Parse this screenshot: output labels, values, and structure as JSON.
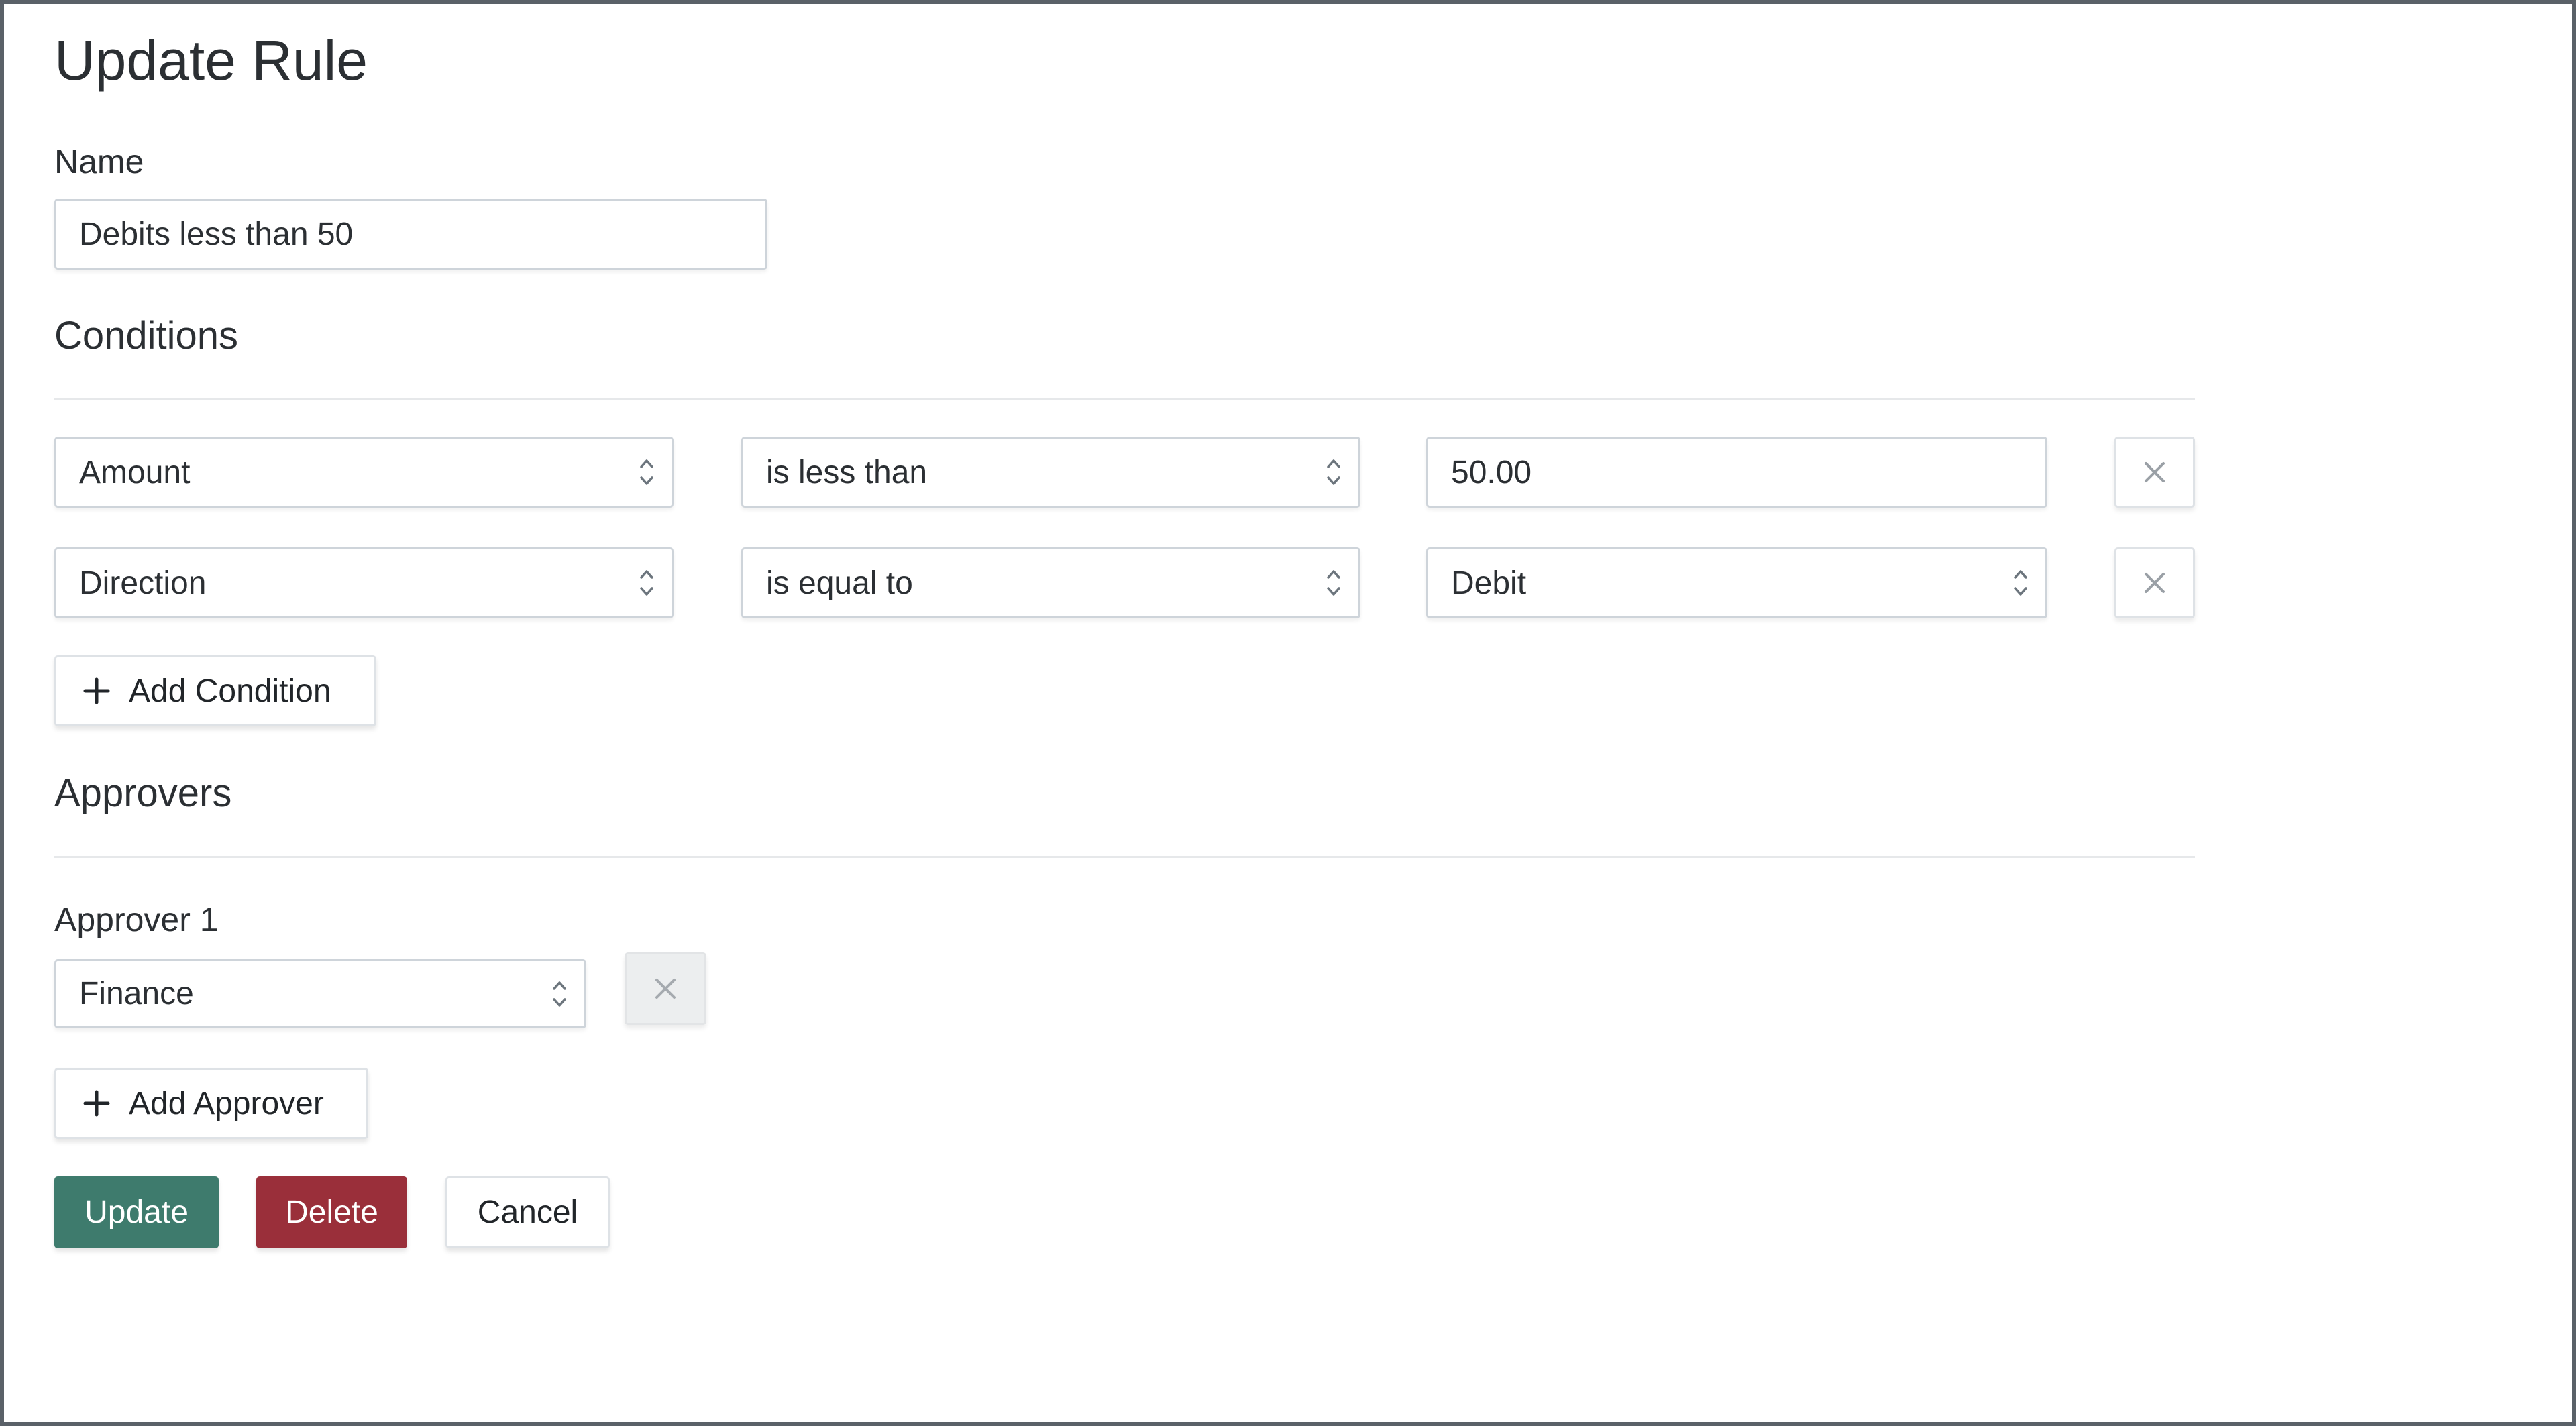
{
  "page": {
    "title": "Update Rule"
  },
  "name_field": {
    "label": "Name",
    "value": "Debits less than 50"
  },
  "conditions": {
    "heading": "Conditions",
    "rows": [
      {
        "field": "Amount",
        "operator": "is less than",
        "value": "50.00",
        "value_type": "input"
      },
      {
        "field": "Direction",
        "operator": "is equal to",
        "value": "Debit",
        "value_type": "select"
      }
    ],
    "add_label": "Add Condition"
  },
  "approvers": {
    "heading": "Approvers",
    "items": [
      {
        "label": "Approver 1",
        "value": "Finance",
        "remove_disabled": true
      }
    ],
    "add_label": "Add Approver"
  },
  "actions": {
    "update_label": "Update",
    "delete_label": "Delete",
    "cancel_label": "Cancel"
  },
  "colors": {
    "update": "#3e7b6d",
    "delete": "#9a2f3a",
    "frame": "#5a6168"
  },
  "icons": {
    "select_indicator": "chevron-up-down-icon",
    "remove": "close-icon",
    "add": "plus-icon"
  }
}
